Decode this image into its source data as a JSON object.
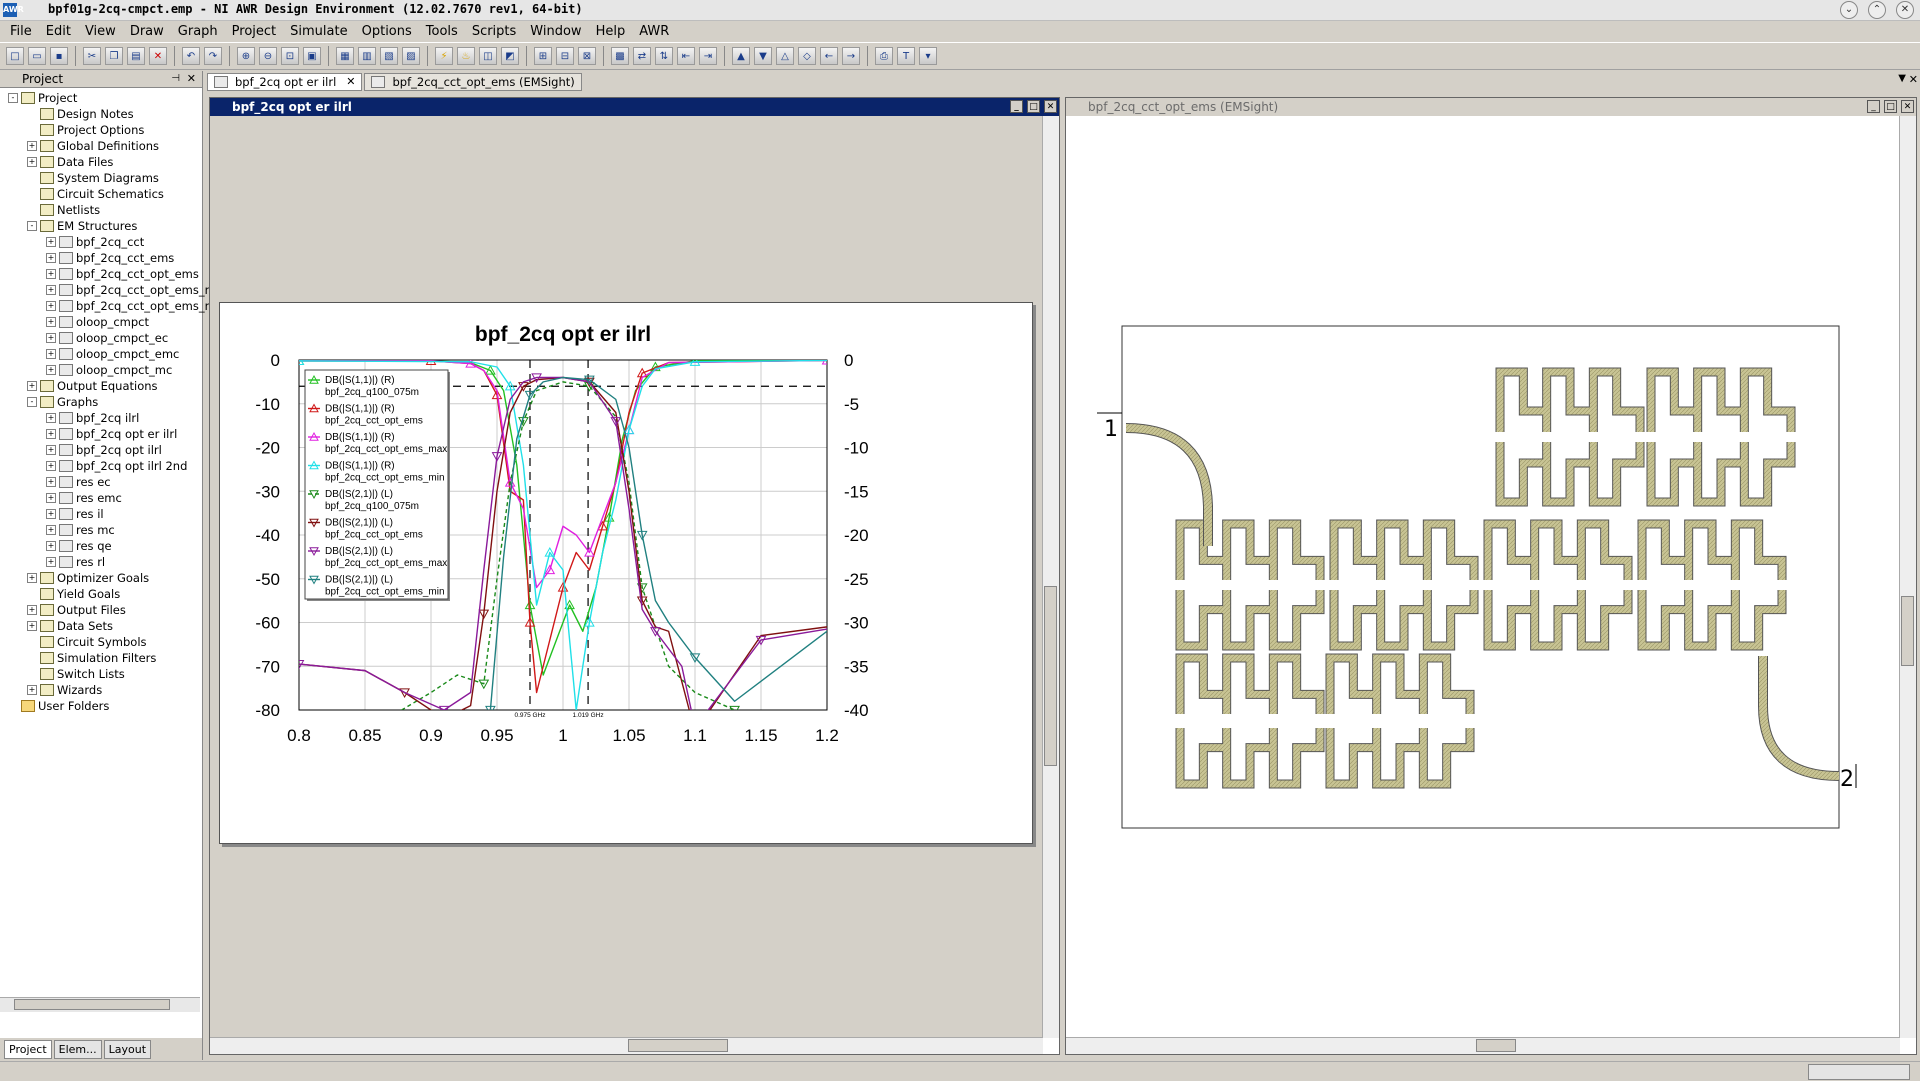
{
  "window": {
    "title": "bpf01g-2cq-cmpct.emp - NI AWR Design Environment (12.02.7670 rev1, 64-bit)"
  },
  "menu": [
    "File",
    "Edit",
    "View",
    "Draw",
    "Graph",
    "Project",
    "Simulate",
    "Options",
    "Tools",
    "Scripts",
    "Window",
    "Help",
    "AWR"
  ],
  "project_panel": {
    "title": "Project",
    "tabs": [
      "Project",
      "Elem...",
      "Layout"
    ],
    "tree": [
      {
        "label": "Project",
        "level": 0,
        "exp": "-"
      },
      {
        "label": "Design Notes",
        "level": 1,
        "exp": ""
      },
      {
        "label": "Project Options",
        "level": 1,
        "exp": ""
      },
      {
        "label": "Global Definitions",
        "level": 1,
        "exp": "+"
      },
      {
        "label": "Data Files",
        "level": 1,
        "exp": "+"
      },
      {
        "label": "System Diagrams",
        "level": 1,
        "exp": ""
      },
      {
        "label": "Circuit Schematics",
        "level": 1,
        "exp": ""
      },
      {
        "label": "Netlists",
        "level": 1,
        "exp": ""
      },
      {
        "label": "EM Structures",
        "level": 1,
        "exp": "-"
      },
      {
        "label": "bpf_2cq_cct",
        "level": 2,
        "exp": "+"
      },
      {
        "label": "bpf_2cq_cct_ems",
        "level": 2,
        "exp": "+"
      },
      {
        "label": "bpf_2cq_cct_opt_ems",
        "level": 2,
        "exp": "+"
      },
      {
        "label": "bpf_2cq_cct_opt_ems_n",
        "level": 2,
        "exp": "+"
      },
      {
        "label": "bpf_2cq_cct_opt_ems_n",
        "level": 2,
        "exp": "+"
      },
      {
        "label": "oloop_cmpct",
        "level": 2,
        "exp": "+"
      },
      {
        "label": "oloop_cmpct_ec",
        "level": 2,
        "exp": "+"
      },
      {
        "label": "oloop_cmpct_emc",
        "level": 2,
        "exp": "+"
      },
      {
        "label": "oloop_cmpct_mc",
        "level": 2,
        "exp": "+"
      },
      {
        "label": "Output Equations",
        "level": 1,
        "exp": "+"
      },
      {
        "label": "Graphs",
        "level": 1,
        "exp": "-"
      },
      {
        "label": "bpf_2cq ilrl",
        "level": 2,
        "exp": "+"
      },
      {
        "label": "bpf_2cq opt er ilrl",
        "level": 2,
        "exp": "+"
      },
      {
        "label": "bpf_2cq opt ilrl",
        "level": 2,
        "exp": "+"
      },
      {
        "label": "bpf_2cq opt ilrl 2nd",
        "level": 2,
        "exp": "+"
      },
      {
        "label": "res ec",
        "level": 2,
        "exp": "+"
      },
      {
        "label": "res emc",
        "level": 2,
        "exp": "+"
      },
      {
        "label": "res il",
        "level": 2,
        "exp": "+"
      },
      {
        "label": "res mc",
        "level": 2,
        "exp": "+"
      },
      {
        "label": "res qe",
        "level": 2,
        "exp": "+"
      },
      {
        "label": "res rl",
        "level": 2,
        "exp": "+"
      },
      {
        "label": "Optimizer Goals",
        "level": 1,
        "exp": "+"
      },
      {
        "label": "Yield Goals",
        "level": 1,
        "exp": ""
      },
      {
        "label": "Output Files",
        "level": 1,
        "exp": "+"
      },
      {
        "label": "Data Sets",
        "level": 1,
        "exp": "+"
      },
      {
        "label": "Circuit Symbols",
        "level": 1,
        "exp": ""
      },
      {
        "label": "Simulation Filters",
        "level": 1,
        "exp": ""
      },
      {
        "label": "Switch Lists",
        "level": 1,
        "exp": ""
      },
      {
        "label": "Wizards",
        "level": 1,
        "exp": "+"
      },
      {
        "label": "User Folders",
        "level": 0,
        "exp": ""
      }
    ]
  },
  "doc_tabs": [
    {
      "label": "bpf_2cq opt er ilrl",
      "close": "✕"
    },
    {
      "label": "bpf_2cq_cct_opt_ems (EMSight)",
      "close": ""
    }
  ],
  "graph_window": {
    "title": "bpf_2cq opt er ilrl"
  },
  "layout_window": {
    "title": "bpf_2cq_cct_opt_ems (EMSight)",
    "port_labels": [
      "1",
      "2"
    ]
  },
  "colors": {
    "title_active": "#0a246a",
    "trace_green": "#22c022",
    "trace_red": "#d01818",
    "trace_magenta": "#e020e0",
    "trace_cyan": "#20e0e8",
    "trace_dgreen": "#1a8a1a",
    "trace_dred": "#801010",
    "trace_purple": "#8a1a9a",
    "trace_teal": "#208080",
    "layout_metal": "#c8c494"
  },
  "chart_data": {
    "type": "line",
    "title": "bpf_2cq opt er ilrl",
    "xlim": [
      0.8,
      1.2
    ],
    "ylim_left": [
      -80,
      0
    ],
    "ylim_right": [
      -40,
      0
    ],
    "x_ticks": [
      "0.8",
      "0.85",
      "0.9",
      "0.95",
      "1",
      "1.05",
      "1.1",
      "1.15",
      "1.2"
    ],
    "y_ticks_left": [
      "0",
      "-10",
      "-20",
      "-30",
      "-40",
      "-50",
      "-60",
      "-70",
      "-80"
    ],
    "y_ticks_right": [
      "0",
      "-5",
      "-10",
      "-15",
      "-20",
      "-25",
      "-30",
      "-35",
      "-40"
    ],
    "markers": [
      {
        "x": 0.975,
        "label": "0.975 GHz"
      },
      {
        "x": 1.019,
        "label": "1.019 GHz"
      }
    ],
    "hline_right": -3,
    "grid": true,
    "legend_position": "top-left",
    "series": [
      {
        "name": "DB(|S(1,1)|) (R)\nbpf_2cq_q100_075m",
        "axis": "R",
        "color": "#22c022",
        "dash": "",
        "marker": "up",
        "x": [
          0.8,
          0.9,
          0.93,
          0.945,
          0.955,
          0.965,
          0.975,
          0.985,
          0.995,
          1.005,
          1.015,
          1.025,
          1.035,
          1.045,
          1.055,
          1.07,
          1.1,
          1.2
        ],
        "y": [
          -0.1,
          -0.1,
          -0.3,
          -1.2,
          -3.5,
          -12,
          -28,
          -36,
          -32,
          -28,
          -31,
          -26,
          -18,
          -9,
          -3.5,
          -0.8,
          -0.1,
          -0.05
        ]
      },
      {
        "name": "DB(|S(1,1)|) (R)\nbpf_2cq_cct_opt_ems",
        "axis": "R",
        "color": "#d01818",
        "dash": "",
        "marker": "up",
        "x": [
          0.8,
          0.9,
          0.93,
          0.94,
          0.95,
          0.96,
          0.97,
          0.975,
          0.98,
          0.99,
          1.0,
          1.01,
          1.02,
          1.03,
          1.04,
          1.05,
          1.06,
          1.08,
          1.2
        ],
        "y": [
          -0.1,
          -0.1,
          -0.4,
          -1.2,
          -4,
          -15,
          -16,
          -30,
          -38,
          -32,
          -26,
          -22,
          -24,
          -19,
          -14,
          -6,
          -1.5,
          -0.3,
          -0.05
        ]
      },
      {
        "name": "DB(|S(1,1)|) (R)\nbpf_2cq_cct_opt_ems_max",
        "axis": "R",
        "color": "#e020e0",
        "dash": "",
        "marker": "up",
        "x": [
          0.8,
          0.9,
          0.93,
          0.94,
          0.95,
          0.96,
          0.97,
          0.98,
          0.99,
          1.0,
          1.01,
          1.02,
          1.03,
          1.04,
          1.05,
          1.06,
          1.08,
          1.2
        ],
        "y": [
          -0.1,
          -0.1,
          -0.4,
          -1.2,
          -3.5,
          -14,
          -17,
          -26,
          -24,
          -19,
          -20,
          -22,
          -18,
          -14,
          -8,
          -2,
          -0.3,
          -0.05
        ]
      },
      {
        "name": "DB(|S(1,1)|) (R)\nbpf_2cq_cct_opt_ems_min",
        "axis": "R",
        "color": "#20e0e8",
        "dash": "",
        "marker": "up",
        "x": [
          0.8,
          0.93,
          0.95,
          0.96,
          0.97,
          0.98,
          0.99,
          1.0,
          1.01,
          1.02,
          1.03,
          1.04,
          1.05,
          1.06,
          1.07,
          1.1,
          1.2
        ],
        "y": [
          -0.1,
          -0.2,
          -0.8,
          -3,
          -12,
          -28,
          -22,
          -24,
          -40,
          -30,
          -22,
          -16,
          -8,
          -3,
          -1,
          -0.2,
          -0.05
        ]
      },
      {
        "name": "DB(|S(2,1)|) (L)\nbpf_2cq_q100_075m",
        "axis": "L",
        "color": "#1a8a1a",
        "dash": "4,3",
        "marker": "down",
        "x": [
          0.8,
          0.85,
          0.9,
          0.92,
          0.94,
          0.95,
          0.96,
          0.97,
          0.98,
          1.0,
          1.02,
          1.04,
          1.05,
          1.06,
          1.08,
          1.1,
          1.13,
          1.15,
          1.2
        ],
        "y": [
          -90,
          -85,
          -76,
          -72,
          -74,
          -50,
          -28,
          -14,
          -7,
          -5,
          -6,
          -13,
          -28,
          -52,
          -70,
          -76,
          -80,
          -86,
          -92
        ]
      },
      {
        "name": "DB(|S(2,1)|) (L)\nbpf_2cq_cct_opt_ems",
        "axis": "L",
        "color": "#801010",
        "dash": "",
        "marker": "down",
        "x": [
          0.8,
          0.85,
          0.88,
          0.91,
          0.93,
          0.94,
          0.95,
          0.96,
          0.97,
          0.98,
          1.0,
          1.02,
          1.04,
          1.05,
          1.06,
          1.07,
          1.08,
          1.1,
          1.15,
          1.2
        ],
        "y": [
          -69.5,
          -71,
          -76,
          -82,
          -79,
          -58,
          -30,
          -12,
          -6,
          -4.5,
          -4,
          -5,
          -12,
          -30,
          -55,
          -61,
          -62,
          -85,
          -63,
          -61
        ]
      },
      {
        "name": "DB(|S(2,1)|) (L)\nbpf_2cq_cct_opt_ems_max",
        "axis": "L",
        "color": "#8a1a9a",
        "dash": "",
        "marker": "down",
        "x": [
          0.8,
          0.85,
          0.88,
          0.91,
          0.93,
          0.94,
          0.95,
          0.96,
          0.97,
          0.98,
          1.0,
          1.02,
          1.04,
          1.05,
          1.06,
          1.07,
          1.09,
          1.1,
          1.15,
          1.2
        ],
        "y": [
          -69.5,
          -71,
          -76,
          -80,
          -76,
          -48,
          -22,
          -9,
          -5,
          -4,
          -4,
          -5,
          -14,
          -34,
          -57,
          -62,
          -70,
          -84,
          -64,
          -61.5
        ]
      },
      {
        "name": "DB(|S(2,1)|) (L)\nbpf_2cq_cct_opt_ems_min",
        "axis": "L",
        "color": "#208080",
        "dash": "",
        "marker": "down",
        "x": [
          0.8,
          0.85,
          0.9,
          0.93,
          0.945,
          0.955,
          0.965,
          0.975,
          0.985,
          1.0,
          1.02,
          1.04,
          1.05,
          1.06,
          1.07,
          1.08,
          1.1,
          1.13,
          1.2
        ],
        "y": [
          -90,
          -86,
          -84,
          -88,
          -80,
          -45,
          -18,
          -8,
          -5,
          -4,
          -4.5,
          -9,
          -20,
          -40,
          -55,
          -60,
          -68,
          -78,
          -62
        ]
      }
    ]
  }
}
